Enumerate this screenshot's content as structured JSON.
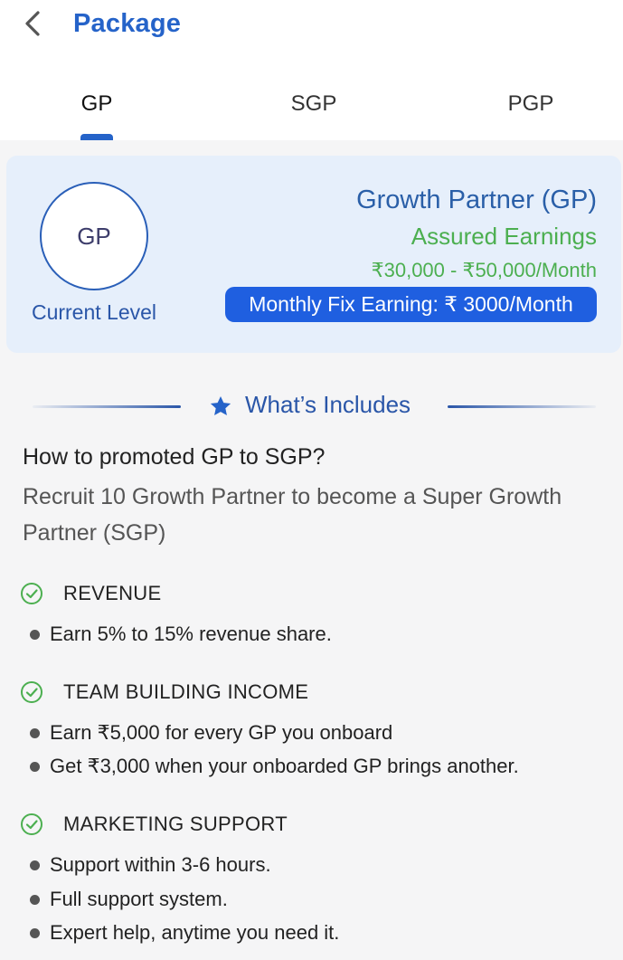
{
  "header": {
    "title": "Package",
    "back_icon": "chevron-left-icon"
  },
  "tabs": [
    {
      "label": "GP",
      "active": true
    },
    {
      "label": "SGP",
      "active": false
    },
    {
      "label": "PGP",
      "active": false
    }
  ],
  "level_card": {
    "badge": "GP",
    "current_level_label": "Current Level",
    "plan_name": "Growth Partner (GP)",
    "assured_label": "Assured Earnings",
    "earning_range": "₹30,000 - ₹50,000/Month",
    "monthly_fix": "Monthly Fix Earning: ₹ 3000/Month"
  },
  "includes": {
    "title": "What’s Includes",
    "icon": "star-icon"
  },
  "promotion": {
    "question": "How to promoted GP to SGP?",
    "answer": "Recruit 10 Growth Partner to become a Super Growth Partner (SGP)"
  },
  "sections": [
    {
      "title": "REVENUE",
      "bullets": [
        "Earn 5% to 15% revenue share."
      ]
    },
    {
      "title": "TEAM BUILDING INCOME",
      "bullets": [
        "Earn ₹5,000 for every GP you onboard",
        "Get ₹3,000 when your onboarded GP brings another."
      ]
    },
    {
      "title": "MARKETING SUPPORT",
      "bullets": [
        "Support within 3-6 hours.",
        "Full support system.",
        "Expert help, anytime you need it."
      ]
    }
  ],
  "colors": {
    "accent": "#2563c9",
    "green": "#4caf50",
    "card_bg": "#e6effb",
    "pill": "#1f5fe0"
  }
}
